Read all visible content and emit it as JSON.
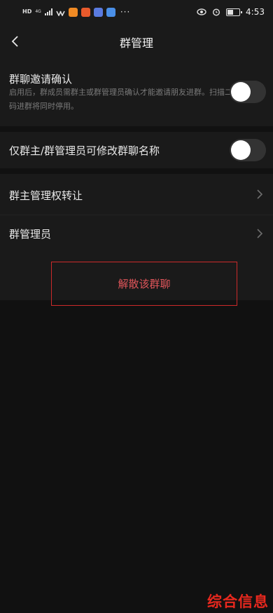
{
  "status_bar": {
    "hd": "HD",
    "network": "4G",
    "network_sub": "46",
    "dots": "···",
    "time": "4:53",
    "battery_level": 0.55
  },
  "header": {
    "title": "群管理"
  },
  "settings": {
    "invite_confirm": {
      "title": "群聊邀请确认",
      "description": "启用后，群成员需群主或群管理员确认才能邀请朋友进群。扫描二维码进群将同时停用。",
      "enabled": false
    },
    "rename_restrict": {
      "title": "仅群主/群管理员可修改群聊名称",
      "enabled": false
    },
    "transfer_owner": {
      "title": "群主管理权转让"
    },
    "admins": {
      "title": "群管理员"
    },
    "disband": {
      "label": "解散该群聊"
    }
  },
  "watermark": "综合信息",
  "colors": {
    "background": "#111111",
    "card": "#1a1a1a",
    "danger": "#e0555a",
    "highlight_box": "#cc2a2a",
    "watermark": "#e8281e"
  }
}
